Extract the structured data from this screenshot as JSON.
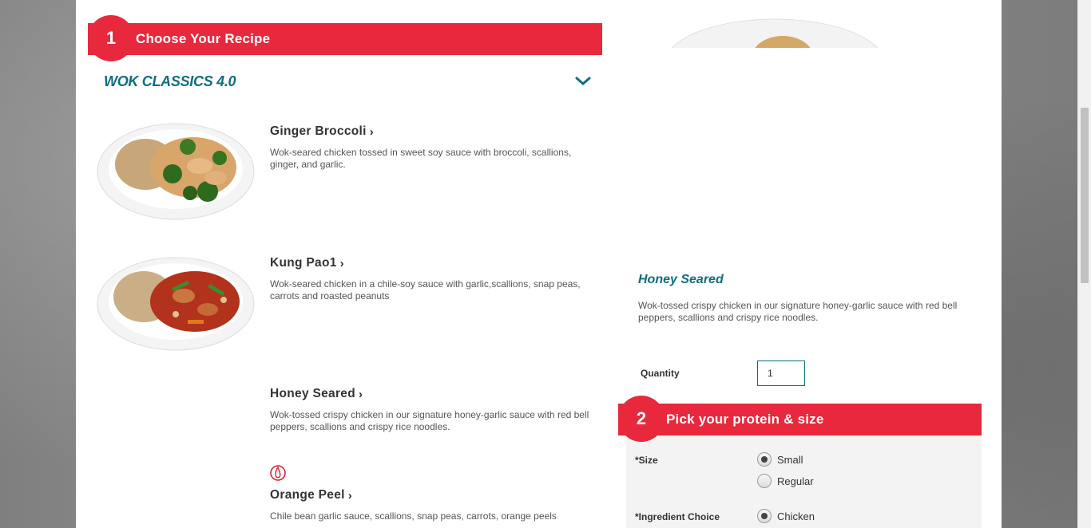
{
  "step1": {
    "number": "1",
    "title": "Choose Your Recipe"
  },
  "category": {
    "name": "WOK CLASSICS 4.0"
  },
  "recipes": [
    {
      "name": "Ginger Broccoli",
      "description": "Wok-seared chicken tossed in sweet soy sauce with broccoli, scallions, ginger, and garlic."
    },
    {
      "name": "Kung Pao1",
      "description": "Wok-seared chicken in a chile-soy sauce with garlic,scallions, snap peas, carrots and roasted peanuts"
    },
    {
      "name": "Honey Seared",
      "description": "Wok-tossed crispy chicken in our signature honey-garlic sauce with red bell peppers, scallions and crispy rice noodles."
    },
    {
      "name": "Orange Peel",
      "description": "Chile bean garlic sauce, scallions, snap peas, carrots, orange peels"
    }
  ],
  "detail": {
    "title": "Honey Seared",
    "description": "Wok-tossed crispy chicken in our signature honey-garlic sauce with red bell peppers, scallions and crispy rice noodles.",
    "quantity_label": "Quantity",
    "quantity_value": "1"
  },
  "step2": {
    "number": "2",
    "title": "Pick your protein & size"
  },
  "options": {
    "size_label": "*Size",
    "size_options": [
      {
        "label": "Small",
        "checked": true
      },
      {
        "label": "Regular",
        "checked": false
      }
    ],
    "ingredient_label": "*Ingredient Choice",
    "ingredient_options": [
      {
        "label": "Chicken",
        "checked": true
      }
    ]
  },
  "colors": {
    "brand_red": "#e8283c",
    "accent_teal": "#0e6e7d"
  }
}
